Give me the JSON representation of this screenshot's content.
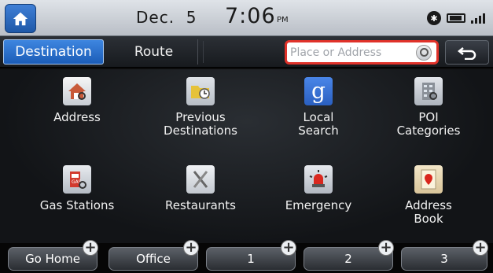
{
  "status": {
    "date": "Dec.  5",
    "time": "7:06",
    "ampm": "PM"
  },
  "tabs": {
    "destination": "Destination",
    "route": "Route"
  },
  "search": {
    "placeholder": "Place or Address"
  },
  "grid": [
    {
      "label": "Address",
      "icon": "house-icon"
    },
    {
      "label": "Previous\nDestinations",
      "icon": "folder-clock-icon"
    },
    {
      "label": "Local\nSearch",
      "icon": "google-icon"
    },
    {
      "label": "POI\nCategories",
      "icon": "building-icon"
    },
    {
      "label": "Gas Stations",
      "icon": "gas-pump-icon"
    },
    {
      "label": "Restaurants",
      "icon": "fork-knife-icon"
    },
    {
      "label": "Emergency",
      "icon": "siren-icon"
    },
    {
      "label": "Address\nBook",
      "icon": "map-pin-book-icon"
    }
  ],
  "favorites": [
    "Go Home",
    "Office",
    "1",
    "2",
    "3"
  ],
  "colors": {
    "tab_active": "#2a70cc",
    "search_border": "#e0322a",
    "statusbar": "#d0d4da"
  }
}
